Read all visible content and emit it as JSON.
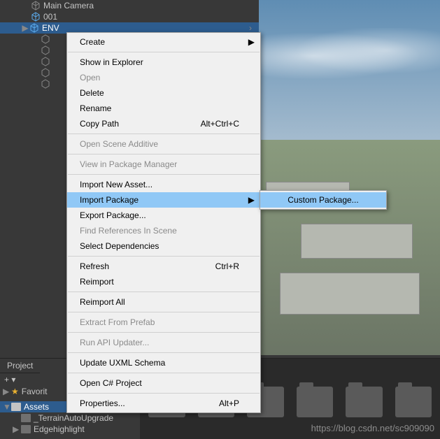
{
  "hierarchy": {
    "items": [
      {
        "label": "Main Camera",
        "blue": false
      },
      {
        "label": "001",
        "blue": true
      },
      {
        "label": "ENV",
        "blue": true,
        "expand": true,
        "selected": true
      }
    ]
  },
  "contextMenu": {
    "create": "Create",
    "showInExplorer": "Show in Explorer",
    "open": "Open",
    "delete": "Delete",
    "rename": "Rename",
    "copyPath": "Copy Path",
    "copyPathShortcut": "Alt+Ctrl+C",
    "openSceneAdditive": "Open Scene Additive",
    "viewInPackageManager": "View in Package Manager",
    "importNewAsset": "Import New Asset...",
    "importPackage": "Import Package",
    "exportPackage": "Export Package...",
    "findReferences": "Find References In Scene",
    "selectDependencies": "Select Dependencies",
    "refresh": "Refresh",
    "refreshShortcut": "Ctrl+R",
    "reimport": "Reimport",
    "reimportAll": "Reimport All",
    "extractFromPrefab": "Extract From Prefab",
    "runApiUpdater": "Run API Updater...",
    "updateUxml": "Update UXML Schema",
    "openCsProject": "Open C# Project",
    "properties": "Properties...",
    "propertiesShortcut": "Alt+P"
  },
  "subMenu": {
    "customPackage": "Custom Package..."
  },
  "projectPanel": {
    "tab": "Project",
    "toolbarPlus": "+",
    "favorites": "Favorit",
    "assets": "Assets",
    "folders": [
      "_TerrainAutoUpgrade",
      "Edgehighlight"
    ]
  },
  "watermark": "https://blog.csdn.net/sc909090"
}
